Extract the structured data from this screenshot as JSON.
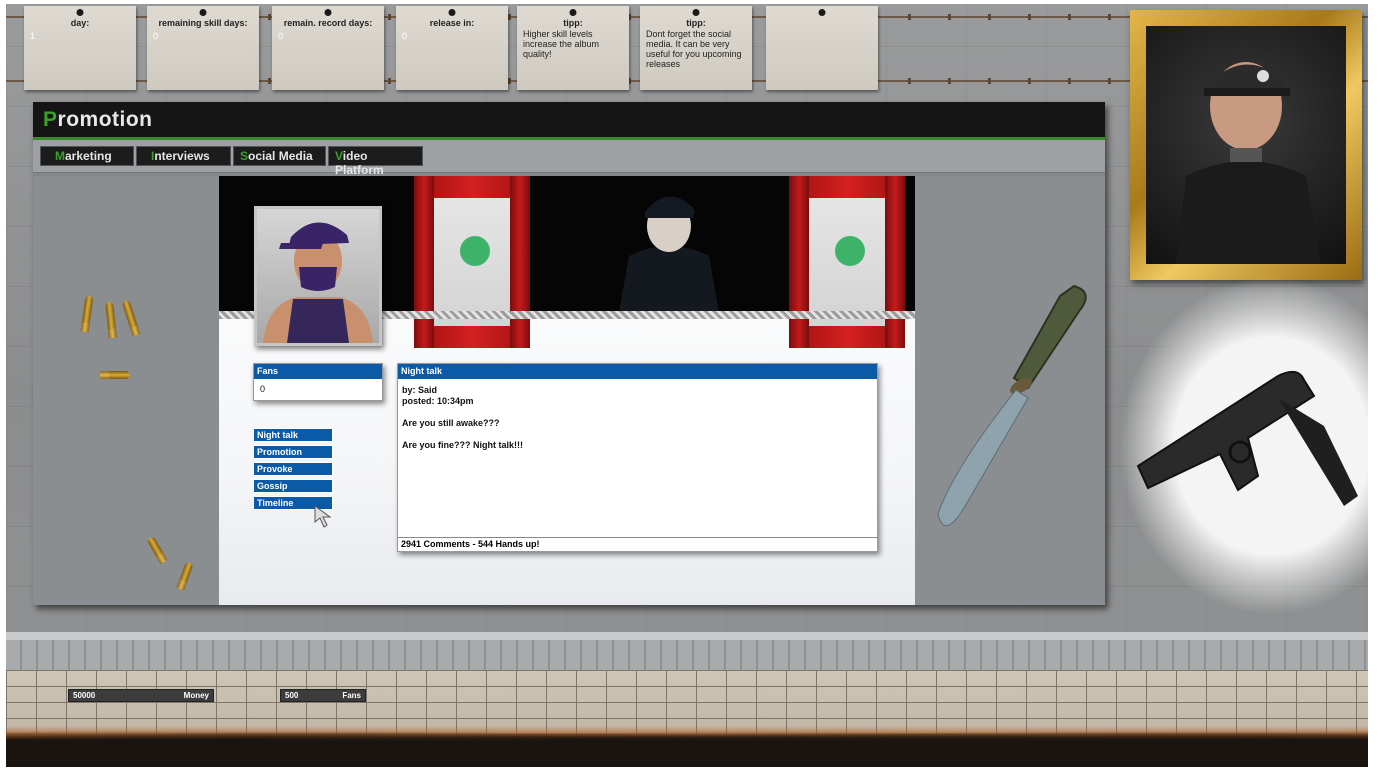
{
  "notes": [
    {
      "title": "day:",
      "value": "1"
    },
    {
      "title": "remaining skill days:",
      "value": "0"
    },
    {
      "title": "remain. record days:",
      "value": "0"
    },
    {
      "title": "release in:",
      "value": "0"
    },
    {
      "title": "tipp:",
      "text": "Higher skill levels increase the album quality!"
    },
    {
      "title": "tipp:",
      "text": "Dont forget the social media. It can be very useful for you upcoming releases"
    },
    {
      "title": "",
      "text": ""
    }
  ],
  "window": {
    "title_first": "P",
    "title_rest": "romotion",
    "tabs": [
      {
        "first": "M",
        "rest": "arketing"
      },
      {
        "first": "I",
        "rest": "nterviews"
      },
      {
        "first": "S",
        "rest": "ocial Media"
      },
      {
        "first": "V",
        "rest": "ideo Platform"
      }
    ]
  },
  "fans_box": {
    "header": "Fans",
    "value": "0"
  },
  "menu": [
    "Night talk",
    "Promotion",
    "Provoke",
    "Gossip",
    "Timeline"
  ],
  "post": {
    "header": "Night talk",
    "by": "by: Said",
    "posted": "posted: 10:34pm",
    "line1": "Are you still awake???",
    "line2": "Are you fine??? Night talk!!!",
    "footer": "2941 Comments - 544 Hands up!"
  },
  "stats": {
    "money_value": "50000",
    "money_label": "Money",
    "fans_value": "500",
    "fans_label": "Fans"
  },
  "colors": {
    "accent_green": "#3aa12c",
    "panel_blue": "#0b5aa8"
  }
}
